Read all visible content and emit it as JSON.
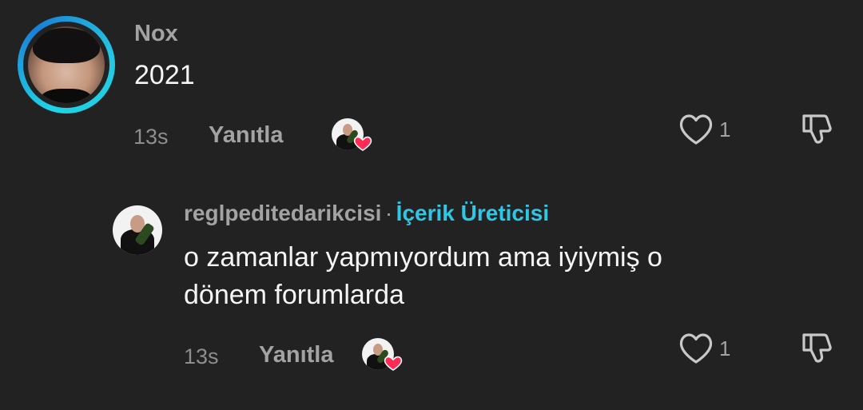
{
  "comment": {
    "username": "Nox",
    "text": "2021",
    "time": "13s",
    "reply_label": "Yanıtla",
    "likes": "1"
  },
  "reply": {
    "username": "reglpeditedarikcisi",
    "separator": "·",
    "badge": "İçerik Üreticisi",
    "text_line1": "o zamanlar yapmıyordum ama iyiymiş o",
    "text_line2": "dönem forumlarda",
    "time": "13s",
    "reply_label": "Yanıtla",
    "likes": "1"
  },
  "colors": {
    "background": "#222222",
    "accent": "#2ec7e5",
    "heart_red": "#ff2b55"
  },
  "icons": [
    "heart-outline-icon",
    "dislike-icon",
    "creator-liked-heart-icon"
  ]
}
